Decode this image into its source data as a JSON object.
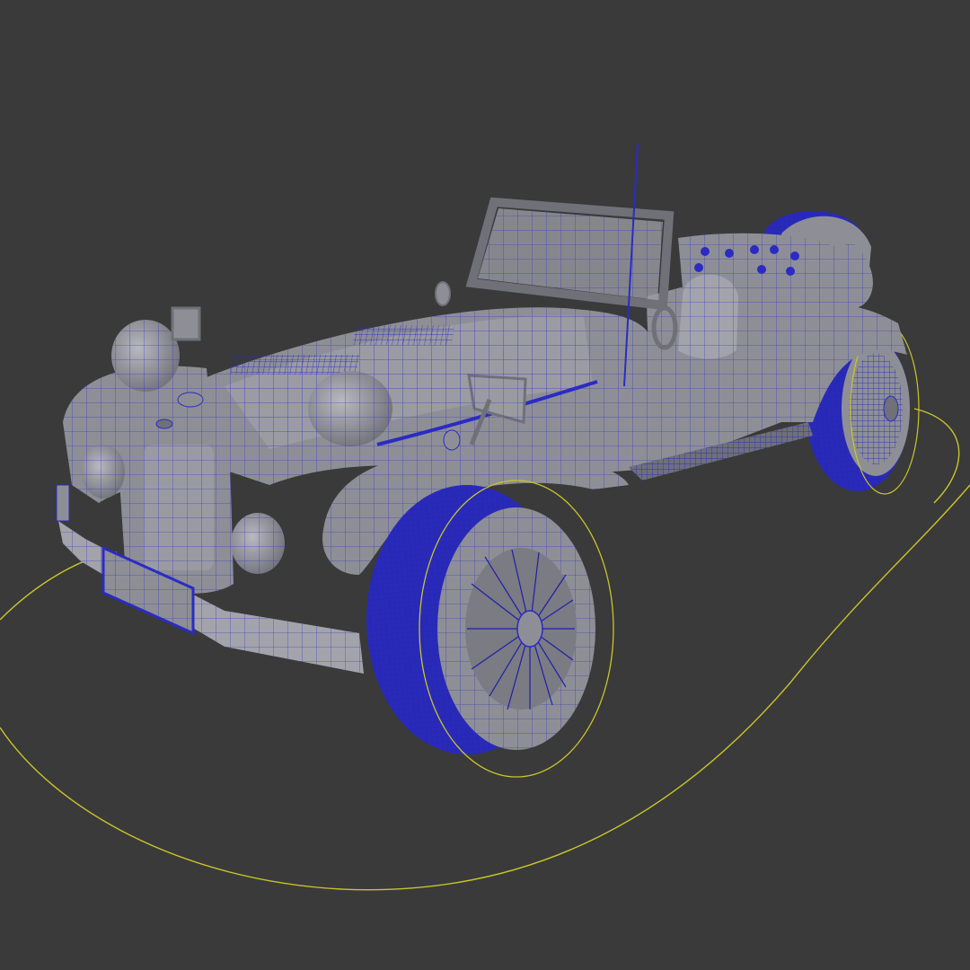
{
  "viewport": {
    "background": "#3a3a3a",
    "shading_mode": "wireframe-on-shaded",
    "object": "vintage-roadster",
    "colors": {
      "surface": "#8e8f96",
      "surface_light": "#a3a4ab",
      "surface_dark": "#6f7078",
      "wire": "#2b2bc4",
      "curve": "#c9c52a"
    },
    "selection": {
      "type": "spline-curves",
      "count": 3
    }
  }
}
